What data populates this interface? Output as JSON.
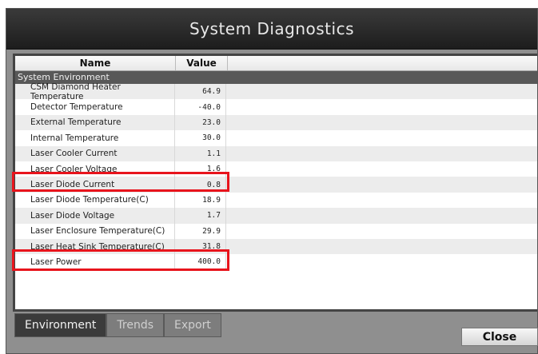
{
  "window": {
    "title": "System Diagnostics"
  },
  "table": {
    "columns": [
      "Name",
      "Value"
    ],
    "group": "System Environment",
    "rows": [
      {
        "name": "CSM Diamond Heater Temperature",
        "value": "64.9"
      },
      {
        "name": "Detector Temperature",
        "value": "-40.0"
      },
      {
        "name": "External Temperature",
        "value": "23.0"
      },
      {
        "name": "Internal Temperature",
        "value": "30.0"
      },
      {
        "name": "Laser Cooler Current",
        "value": "1.1"
      },
      {
        "name": "Laser Cooler Voltage",
        "value": "1.6"
      },
      {
        "name": "Laser Diode Current",
        "value": "0.8",
        "highlighted": true
      },
      {
        "name": "Laser Diode Temperature(C)",
        "value": "18.9"
      },
      {
        "name": "Laser Diode Voltage",
        "value": "1.7"
      },
      {
        "name": "Laser Enclosure Temperature(C)",
        "value": "29.9"
      },
      {
        "name": "Laser Heat Sink Temperature(C)",
        "value": "31.8"
      },
      {
        "name": "Laser Power",
        "value": "400.0",
        "highlighted": true
      }
    ]
  },
  "tabs": [
    {
      "label": "Environment",
      "active": true
    },
    {
      "label": "Trends",
      "active": false
    },
    {
      "label": "Export",
      "active": false
    }
  ],
  "buttons": {
    "close": "Close"
  },
  "colors": {
    "highlight": "#e8141c",
    "titlebar": "#2a2a2a",
    "group_header": "#585858"
  }
}
